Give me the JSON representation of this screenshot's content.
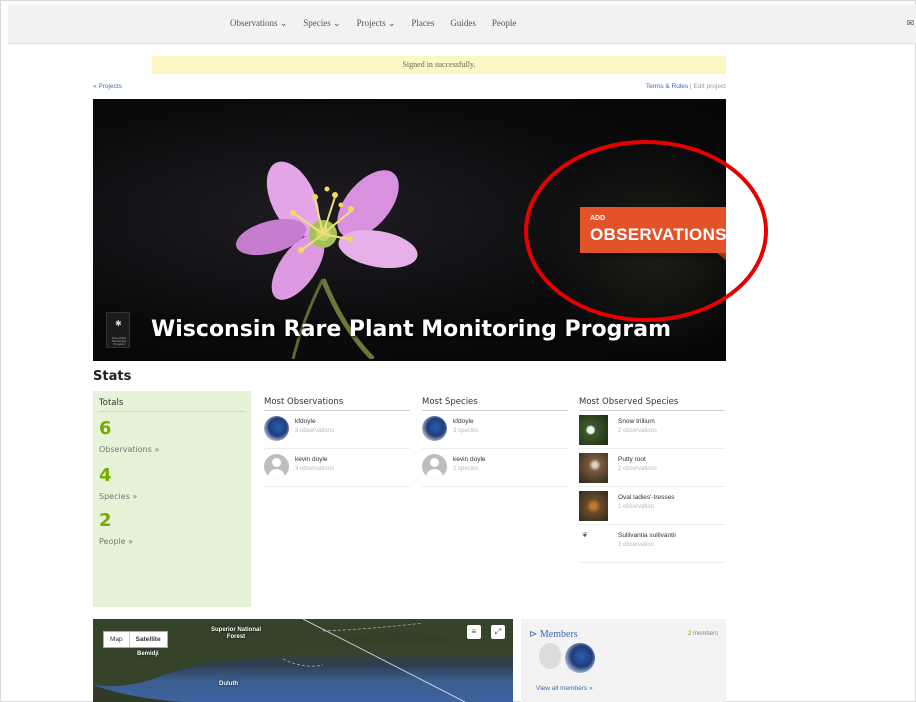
{
  "nav": {
    "items": [
      "Observations ⌄",
      "Species ⌄",
      "Projects ⌄",
      "Places",
      "Guides",
      "People"
    ],
    "mail_icon": "mail-icon"
  },
  "flash": "Signed in successfully.",
  "links": {
    "back": "« Projects",
    "terms": "Terms & Rules",
    "separator": "|",
    "edit": "Edit project"
  },
  "banner": {
    "add_small": "ADD",
    "add_big": "OBSERVATIONS",
    "title": "Wisconsin Rare Plant Monitoring Program",
    "logo_text": "Rare Plant Monitoring Program",
    "accent": "#e4522a",
    "highlight_circle": "#e60000"
  },
  "stats": {
    "heading": "Stats",
    "totals": {
      "head": "Totals",
      "obs_num": "6",
      "obs_label": "Observations »",
      "species_num": "4",
      "species_label": "Species »",
      "people_num": "2",
      "people_label": "People »"
    },
    "most_obs": {
      "head": "Most Observations",
      "rows": [
        {
          "name": "kfdoyle",
          "sub": "3 observations"
        },
        {
          "name": "kevin doyle",
          "sub": "3 observations"
        }
      ]
    },
    "most_species": {
      "head": "Most Species",
      "rows": [
        {
          "name": "kfdoyle",
          "sub": "3 species"
        },
        {
          "name": "kevin doyle",
          "sub": "2 species"
        }
      ]
    },
    "most_observed": {
      "head": "Most Observed Species",
      "rows": [
        {
          "name": "Snow trillium",
          "sub": "2 observations"
        },
        {
          "name": "Putty root",
          "sub": "2 observations"
        },
        {
          "name": "Oval ladies'-tresses",
          "sub": "1 observation"
        },
        {
          "name": "Sullivantia sullivantii",
          "sub": "1 observation"
        }
      ]
    },
    "green": "#74ac00"
  },
  "map": {
    "map_label": "Map",
    "satellite_label": "Satellite",
    "labels": [
      "Superior National Forest",
      "Bemidji",
      "Duluth"
    ]
  },
  "members": {
    "title": "Members",
    "count_num": "2",
    "count_label": "members",
    "view_all": "View all members »"
  }
}
